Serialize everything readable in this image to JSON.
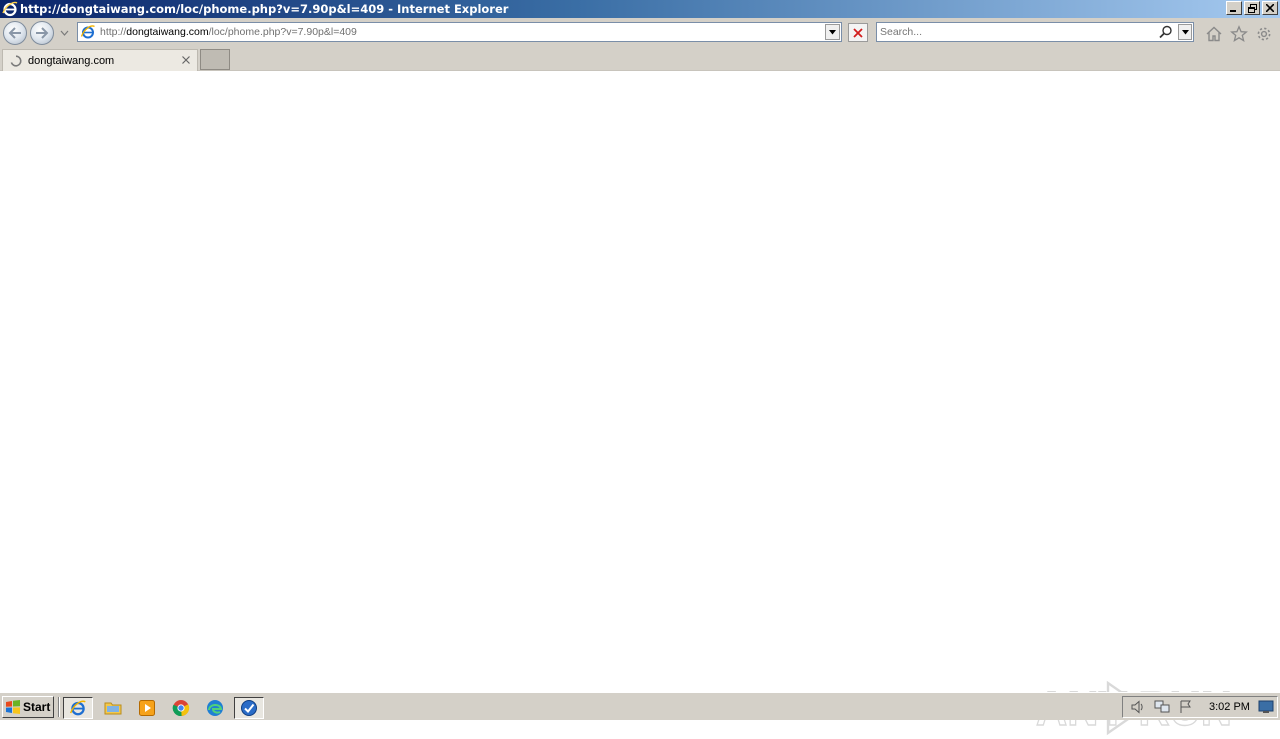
{
  "window": {
    "title": "http://dongtaiwang.com/loc/phome.php?v=7.90p&l=409 - Internet Explorer",
    "minimize_icon": "minimize-icon",
    "restore_icon": "restore-icon",
    "close_icon": "close-icon"
  },
  "navbar": {
    "url_prefix": "http://",
    "url_domain": "dongtaiwang.com",
    "url_path": "/loc/phome.php?v=7.90p&l=409",
    "search_placeholder": "Search..."
  },
  "tabs": [
    {
      "title": "dongtaiwang.com",
      "loading": true
    }
  ],
  "watermark": {
    "text": "ANY RUN"
  },
  "taskbar": {
    "start_label": "Start",
    "clock": "3:02 PM",
    "pinned": [
      "internet-explorer",
      "file-explorer",
      "media-player",
      "chrome",
      "edge",
      "anyrun-agent"
    ]
  },
  "colors": {
    "titlebar_start": "#0a246a",
    "titlebar_end": "#a6caf0",
    "chrome": "#d4d0c8"
  }
}
